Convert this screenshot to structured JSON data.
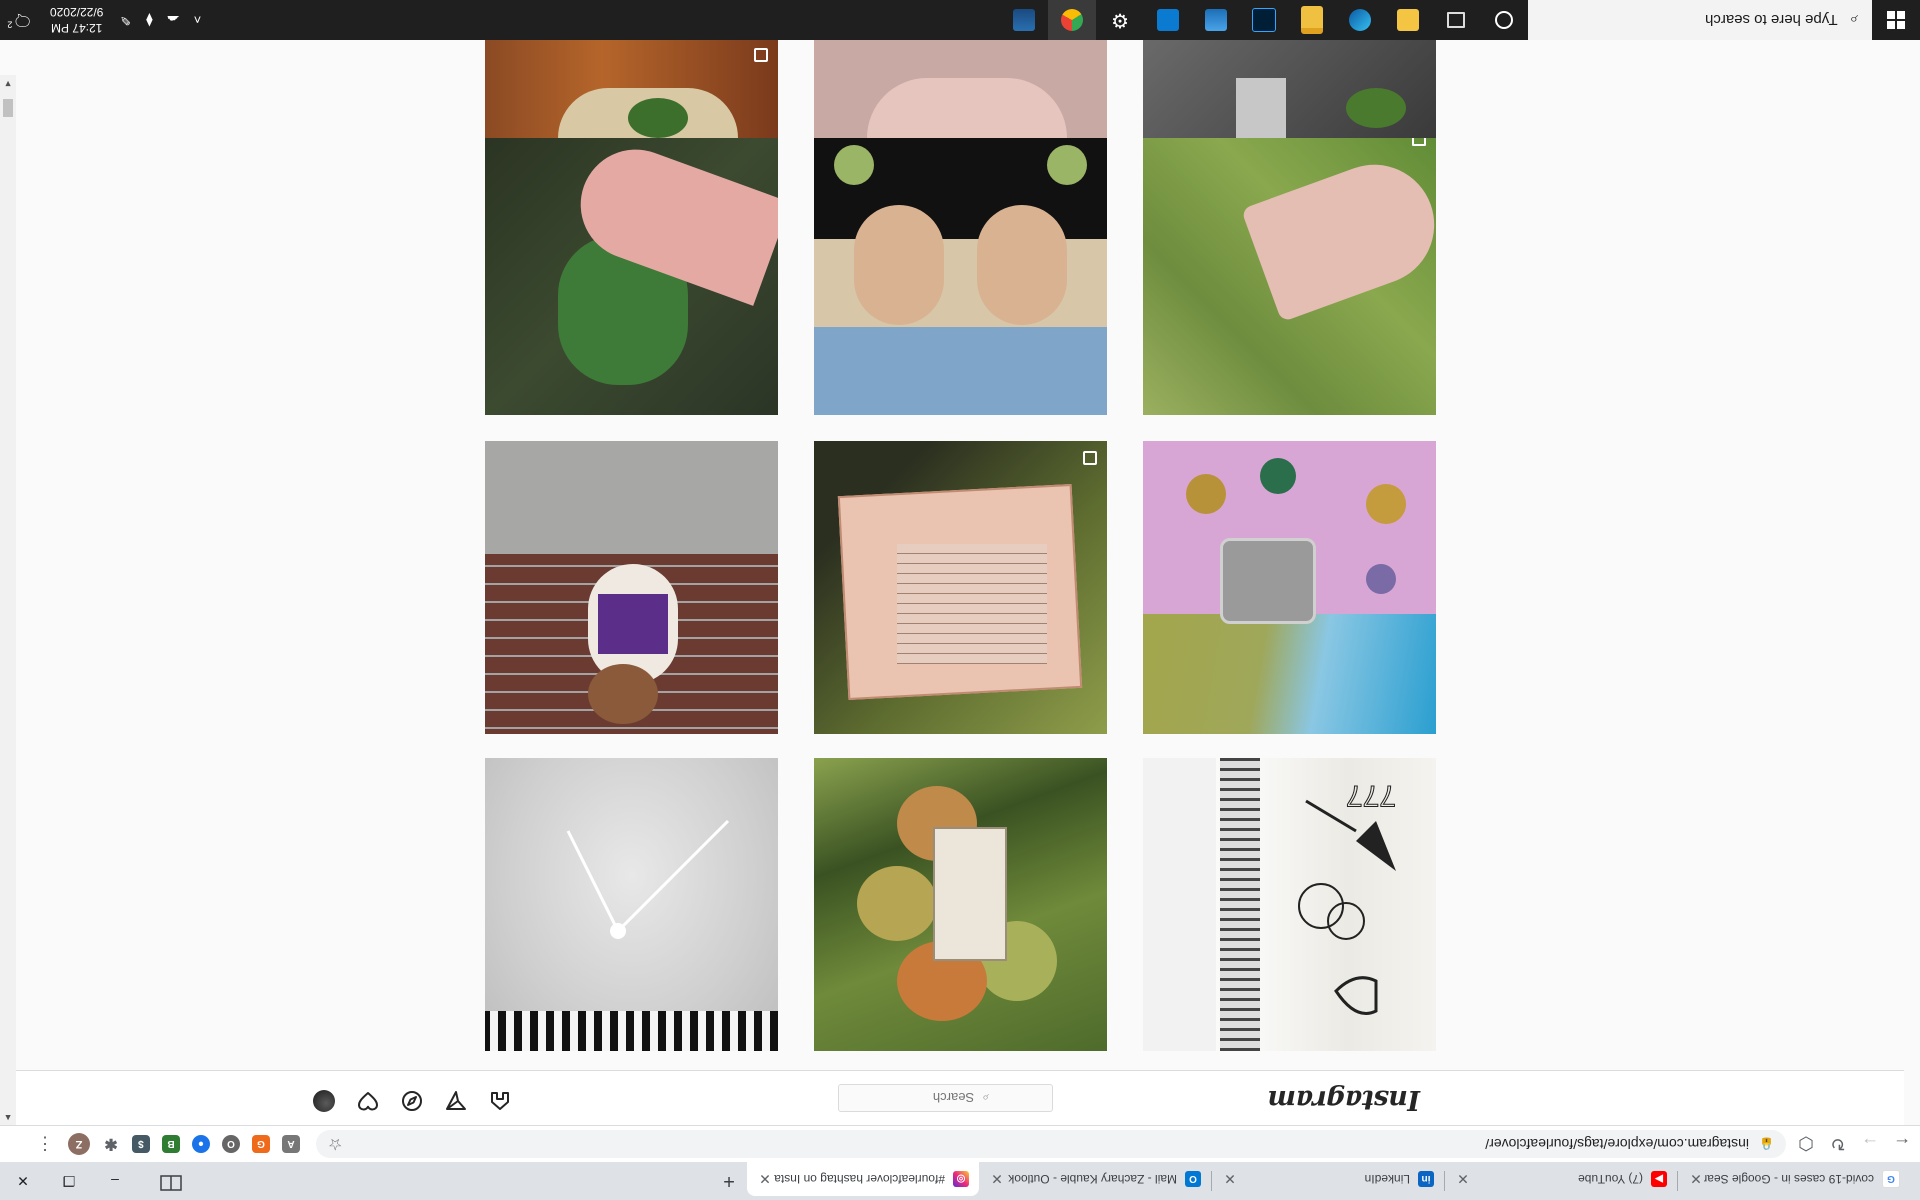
{
  "browser": {
    "tabs": [
      {
        "title": "covid-19 cases in - Google Sear",
        "icon": "google-icon",
        "color": "#4285f4"
      },
      {
        "title": "(7) YouTube",
        "icon": "youtube-icon",
        "color": "#ff0000"
      },
      {
        "title": "LinkedIn",
        "icon": "linkedin-icon",
        "color": "#0a66c2"
      },
      {
        "title": "Mail - Zachary Kauble - Outlook",
        "icon": "outlook-icon",
        "color": "#0078d4"
      },
      {
        "title": "#fourleafclover hashtag on Insta",
        "icon": "instagram-icon",
        "color": "#e1306c",
        "active": true
      }
    ],
    "new_tab": "+",
    "window_controls": {
      "minimize": "–",
      "restore": "❐",
      "close": "✕"
    },
    "address": "instagram.com/explore/tags/fourleafclover/",
    "extensions": [
      "A",
      "G",
      "O",
      "●",
      "B",
      "$",
      "✱",
      "Z"
    ],
    "menu": "⋮"
  },
  "instagram": {
    "logo": "Instagram",
    "search_placeholder": "Search",
    "nav_icons": [
      "home-icon",
      "direct-icon",
      "explore-icon",
      "activity-icon",
      "profile-avatar"
    ]
  },
  "grid": {
    "rows": 4,
    "columns": 3,
    "tiles": [
      {
        "desc": "sketchbook doodles",
        "badge": ""
      },
      {
        "desc": "apples in tree",
        "badge": ""
      },
      {
        "desc": "white fabric with glitter",
        "badge": ""
      },
      {
        "desc": "vintage brooches",
        "badge": ""
      },
      {
        "desc": "collage letter",
        "badge": "carousel"
      },
      {
        "desc": "dog on bricks",
        "badge": ""
      },
      {
        "desc": "hand with clover",
        "badge": ""
      },
      {
        "desc": "mirrored portrait",
        "badge": ""
      },
      {
        "desc": "hand in grass",
        "badge": "video"
      },
      {
        "desc": "clover bowl",
        "badge": "carousel"
      },
      {
        "desc": "skin",
        "badge": ""
      },
      {
        "desc": "clover reflection",
        "badge": ""
      }
    ]
  },
  "taskbar": {
    "search_placeholder": "Type here to search",
    "apps": [
      "cortana-icon",
      "task-view-icon",
      "file-explorer-icon",
      "edge-icon",
      "mail-folder-icon",
      "photoshop-icon",
      "onedrive-icon",
      "store-icon",
      "settings-icon",
      "chrome-icon",
      "photos-icon"
    ],
    "time": "12:47 PM",
    "date": "9/22/2020",
    "notification_count": "2"
  },
  "colors": {
    "ig_bg": "#fafafa",
    "taskbar": "#1f1f1f",
    "tab_strip": "#dee1e6"
  }
}
